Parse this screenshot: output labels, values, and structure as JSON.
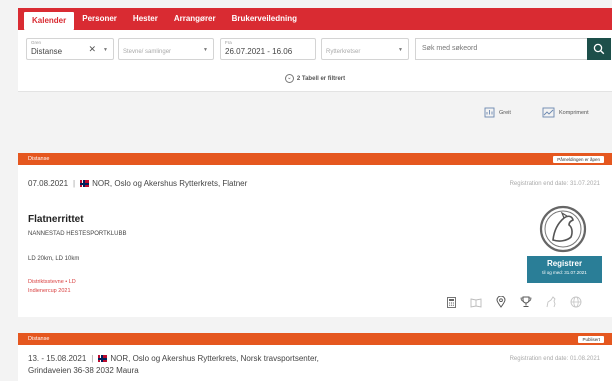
{
  "nav": {
    "items": [
      "Kalender",
      "Personer",
      "Hester",
      "Arrangører",
      "Brukerveiledning"
    ],
    "active_index": 0
  },
  "filters": {
    "type": {
      "label": "Gren",
      "value": "Distanse"
    },
    "stevner": {
      "placeholder": "Stevne/ samlinger"
    },
    "date": {
      "label": "Fra",
      "value": "26.07.2021 - 16.06"
    },
    "rytterkrets": {
      "placeholder": "Rytterkretser"
    },
    "search": {
      "placeholder": "Søk med søkeord"
    },
    "toggle_label": "2 Tabell er filtrert"
  },
  "view": {
    "grid_label": "Greit",
    "compact_label": "Kompriment"
  },
  "events": [
    {
      "type": "Distanse",
      "badge": "Påmeldingen er åpen",
      "date": "07.08.2021",
      "location": "NOR, Oslo og Akershus Rytterkrets, Flatner",
      "reg_end": "Registration end date: 31.07.2021",
      "title": "Flatnerrittet",
      "club": "NANNESTAD HESTESPORTKLUBB",
      "distances": "LD 20km, LD 10km",
      "tag1": "Distriktsstevne • LD",
      "tag2": "Indienercup 2021",
      "register_label": "Registrer",
      "register_sub": "til og med: 31.07.2021"
    },
    {
      "type": "Distanse",
      "badge": "Publisert",
      "date": "13. - 15.08.2021",
      "location": "NOR, Oslo og Akershus Rytterkrets, Norsk travsportsenter,",
      "location2": "Grindaveien 36-38 2032 Maura",
      "reg_end": "Registration end date: 01.08.2021"
    }
  ],
  "colors": {
    "brand_red": "#d92b32",
    "header_orange": "#e5571f",
    "search_button": "#1d4f4a",
    "register_button": "#2a7e97"
  }
}
